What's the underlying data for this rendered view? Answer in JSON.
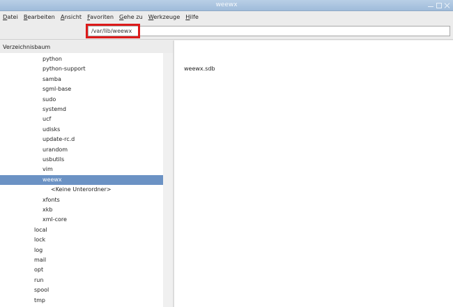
{
  "window": {
    "title": "weewx"
  },
  "menu": [
    {
      "accel": "D",
      "rest": "atei"
    },
    {
      "accel": "B",
      "rest": "earbeiten"
    },
    {
      "accel": "A",
      "rest": "nsicht"
    },
    {
      "accel": "F",
      "rest": "avoriten"
    },
    {
      "accel": "G",
      "rest": "ehe zu"
    },
    {
      "accel": "W",
      "rest": "erkzeuge"
    },
    {
      "accel": "H",
      "rest": "ilfe"
    }
  ],
  "address": {
    "value": "/var/lib/weewx"
  },
  "tree": {
    "header": "Verzeichnisbaum",
    "items": [
      {
        "label": "python",
        "level": 2
      },
      {
        "label": "python-support",
        "level": 2
      },
      {
        "label": "samba",
        "level": 2
      },
      {
        "label": "sgml-base",
        "level": 2
      },
      {
        "label": "sudo",
        "level": 2
      },
      {
        "label": "systemd",
        "level": 2
      },
      {
        "label": "ucf",
        "level": 2
      },
      {
        "label": "udisks",
        "level": 2
      },
      {
        "label": "update-rc.d",
        "level": 2
      },
      {
        "label": "urandom",
        "level": 2
      },
      {
        "label": "usbutils",
        "level": 2
      },
      {
        "label": "vim",
        "level": 2
      },
      {
        "label": "weewx",
        "level": 2,
        "selected": true
      },
      {
        "label": "<Keine Unterordner>",
        "level": 3
      },
      {
        "label": "xfonts",
        "level": 2
      },
      {
        "label": "xkb",
        "level": 2
      },
      {
        "label": "xml-core",
        "level": 2
      },
      {
        "label": "local",
        "level": 1
      },
      {
        "label": "lock",
        "level": 1
      },
      {
        "label": "log",
        "level": 1
      },
      {
        "label": "mail",
        "level": 1
      },
      {
        "label": "opt",
        "level": 1
      },
      {
        "label": "run",
        "level": 1
      },
      {
        "label": "spool",
        "level": 1
      },
      {
        "label": "tmp",
        "level": 1
      }
    ]
  },
  "files": [
    {
      "name": "weewx.sdb"
    }
  ],
  "colors": {
    "highlight_box": "#dd1b1b",
    "selection": "#6b92c4"
  }
}
